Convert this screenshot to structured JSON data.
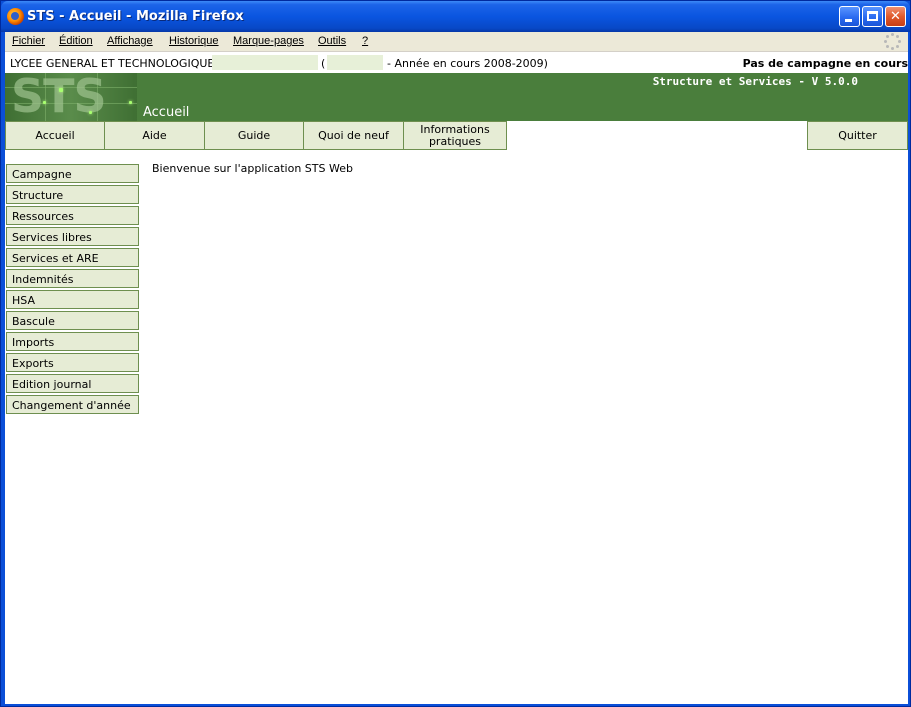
{
  "window": {
    "title": "STS - Accueil - Mozilla Firefox"
  },
  "browser_menu": {
    "items": [
      {
        "label": "Fichier"
      },
      {
        "label": "Édition"
      },
      {
        "label": "Affichage"
      },
      {
        "label": "Historique"
      },
      {
        "label": "Marque-pages"
      },
      {
        "label": "Outils"
      },
      {
        "label": "?"
      }
    ]
  },
  "header": {
    "school": "LYCEE GENERAL ET TECHNOLOGIQUE",
    "paren_open": "(",
    "school_year": "- Année en cours 2008-2009)",
    "campaign_status": "Pas de campagne en cours"
  },
  "banner": {
    "logo_text": "STS",
    "page_title": "Accueil",
    "app_name": "Structure et Services - V 5.0.0"
  },
  "topnav": {
    "tabs": [
      {
        "label": "Accueil"
      },
      {
        "label": "Aide"
      },
      {
        "label": "Guide"
      },
      {
        "label": "Quoi de neuf"
      },
      {
        "label_line1": "Informations",
        "label_line2": "pratiques"
      }
    ],
    "quit": "Quitter"
  },
  "sidebar": {
    "items": [
      {
        "label": "Campagne"
      },
      {
        "label": "Structure"
      },
      {
        "label": "Ressources"
      },
      {
        "label": "Services libres"
      },
      {
        "label": "Services et ARE"
      },
      {
        "label": "Indemnités"
      },
      {
        "label": "HSA"
      },
      {
        "label": "Bascule"
      },
      {
        "label": "Imports"
      },
      {
        "label": "Exports"
      },
      {
        "label": "Edition journal"
      },
      {
        "label": "Changement d'année"
      }
    ]
  },
  "main": {
    "welcome": "Bienvenue sur l'application STS Web"
  },
  "colors": {
    "banner_green": "#4a7e3c",
    "button_bg": "#e6ecd5",
    "button_border": "#6e8f4f",
    "titlebar_blue": "#0a55e0"
  }
}
